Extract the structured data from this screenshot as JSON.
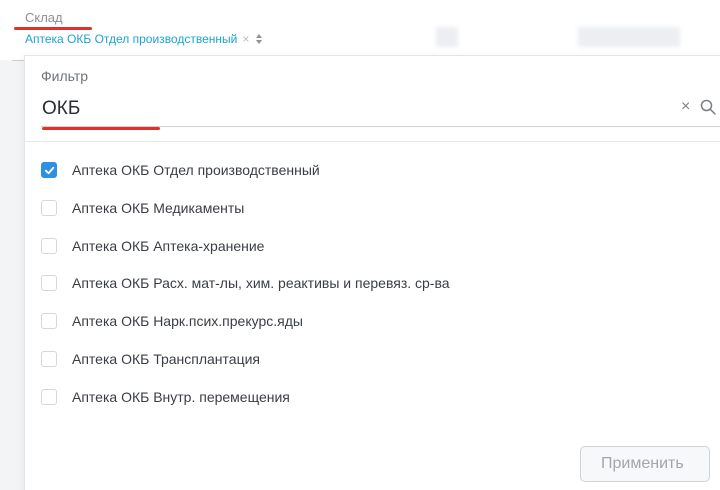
{
  "field": {
    "label": "Склад",
    "value": "Аптека ОКБ Отдел производственный",
    "clear_symbol": "×"
  },
  "filter": {
    "label": "Фильтр",
    "value": "ОКБ",
    "clear_symbol": "×",
    "search_icon": "search-icon"
  },
  "options": [
    {
      "label": "Аптека ОКБ Отдел производственный",
      "checked": true
    },
    {
      "label": "Аптека ОКБ Медикаменты",
      "checked": false
    },
    {
      "label": "Аптека ОКБ Аптека-хранение",
      "checked": false
    },
    {
      "label": "Аптека ОКБ Расх. мат-лы, хим. реактивы и перевяз. ср-ва",
      "checked": false
    },
    {
      "label": "Аптека ОКБ Нарк.псих.прекурс.яды",
      "checked": false
    },
    {
      "label": "Аптека ОКБ Трансплантация",
      "checked": false
    },
    {
      "label": "Аптека ОКБ Внутр. перемещения",
      "checked": false
    }
  ],
  "apply_button": {
    "label": "Применить",
    "disabled": true
  },
  "colors": {
    "accent_link": "#1ba3d6",
    "checkbox_checked": "#2f8fe0",
    "highlight_underline": "#e0312b"
  }
}
